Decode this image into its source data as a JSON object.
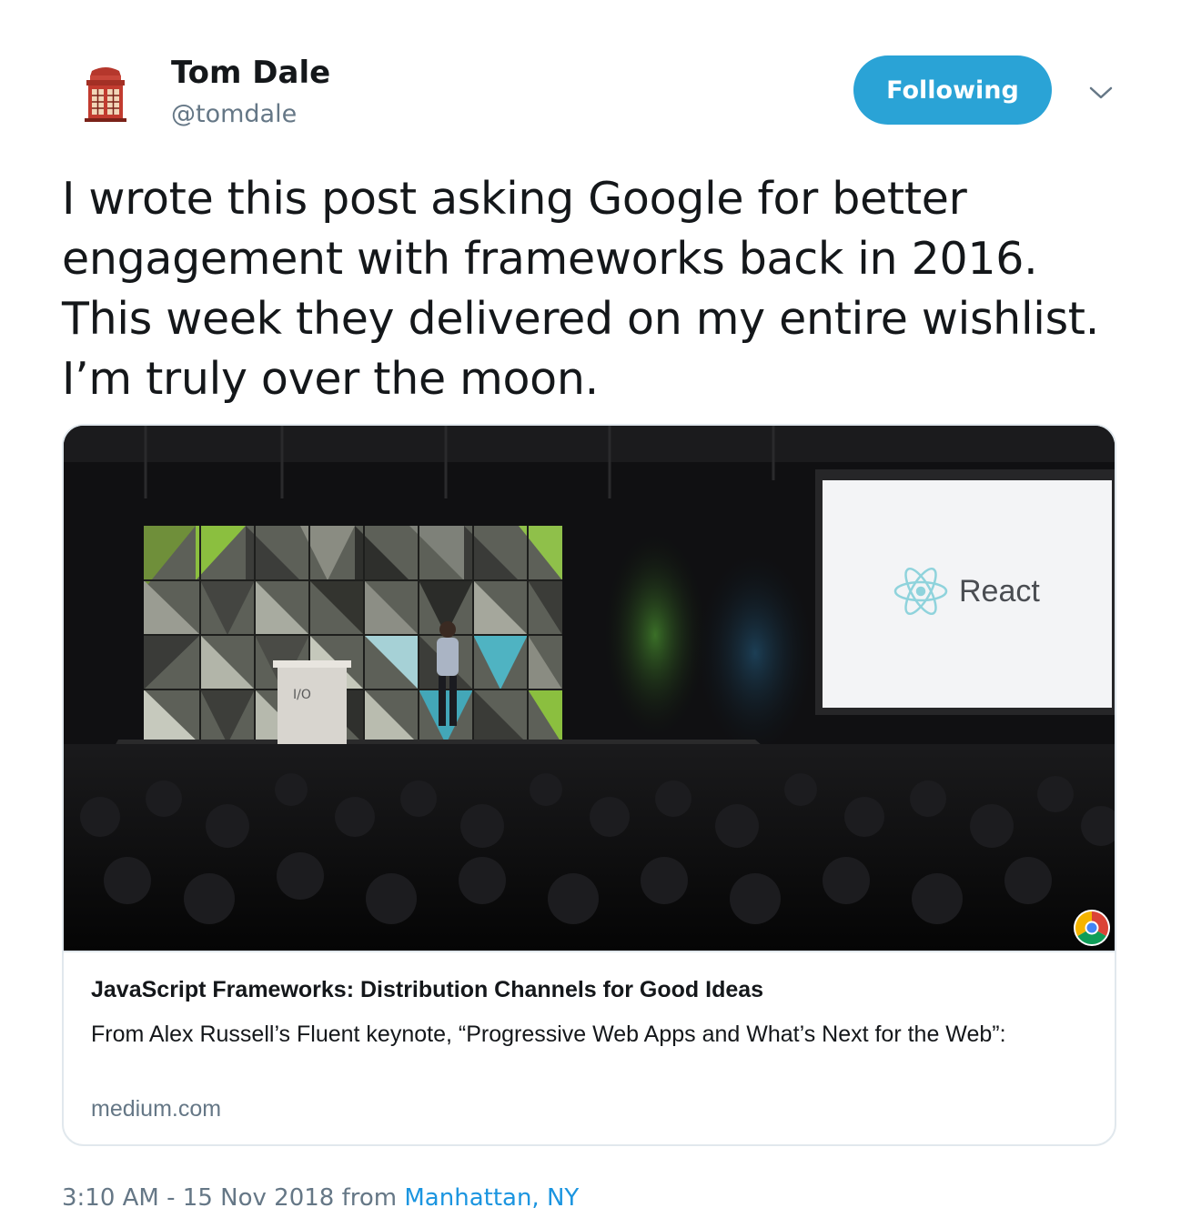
{
  "author": {
    "name": "Tom Dale",
    "handle": "@tomdale",
    "avatar_icon": "phone-booth-avatar-icon"
  },
  "follow_button": {
    "label": "Following",
    "color": "#2aa3d6"
  },
  "menu_icon": "chevron-down-icon",
  "tweet": {
    "text": "I wrote this post asking Google for better engagement with frameworks back in 2016. This week they delivered on my entire wishlist. I’m truly over the moon."
  },
  "card": {
    "image": {
      "screen_text": "React",
      "podium_logo": "I/O",
      "badge_icon": "chrome-icon"
    },
    "title": "JavaScript Frameworks: Distribution Channels for Good Ideas",
    "description": "From Alex Russell’s Fluent keynote, “Progressive Web Apps and What’s Next for the Web”:",
    "domain": "medium.com"
  },
  "meta": {
    "time": "3:10 AM",
    "separator": " - ",
    "date": "15 Nov 2018",
    "from": " from ",
    "location": "Manhattan, NY"
  }
}
